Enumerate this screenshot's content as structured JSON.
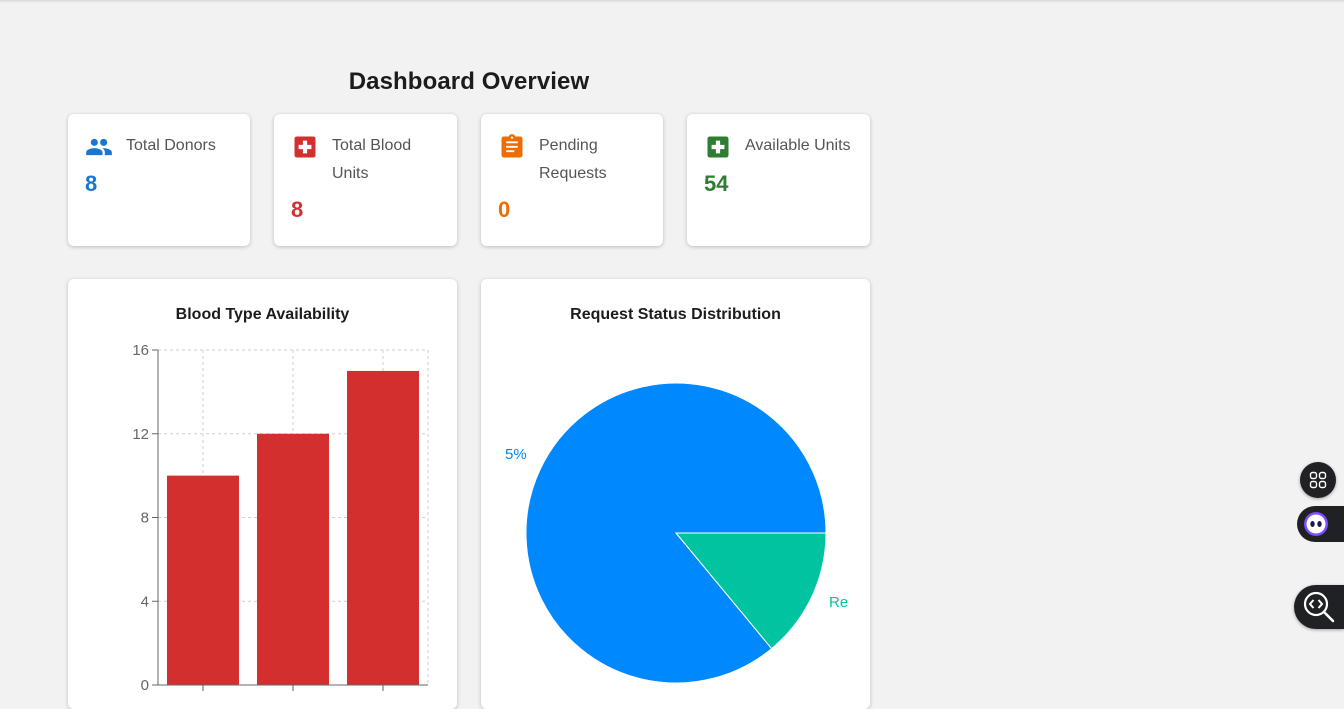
{
  "page": {
    "title": "Dashboard Overview"
  },
  "stats": [
    {
      "label": "Total Donors",
      "value": "8",
      "color": "#1976d2",
      "icon": "people-icon"
    },
    {
      "label": "Total Blood Units",
      "value": "8",
      "color": "#d32f2f",
      "icon": "medical-cross-icon"
    },
    {
      "label": "Pending Requests",
      "value": "0",
      "color": "#ef6c00",
      "icon": "clipboard-icon"
    },
    {
      "label": "Available Units",
      "value": "54",
      "color": "#2e7d32",
      "icon": "hospital-plus-icon"
    }
  ],
  "bar_panel": {
    "title": "Blood Type Availability"
  },
  "pie_panel": {
    "title": "Request Status Distribution"
  },
  "chart_data": [
    {
      "type": "bar",
      "title": "Blood Type Availability",
      "categories": [
        "",
        "",
        ""
      ],
      "values": [
        10,
        12,
        15
      ],
      "ylim": [
        0,
        16
      ],
      "yticks": [
        "0",
        "4",
        "8",
        "12",
        "16"
      ],
      "grid": true,
      "color": "#d32f2f"
    },
    {
      "type": "pie",
      "title": "Request Status Distribution",
      "values": [
        86,
        14
      ],
      "colors": [
        "#0088fe",
        "#00c49f"
      ],
      "visible_labels": [
        "5%",
        "Re"
      ]
    }
  ],
  "floating_tools": [
    "apps-grid-icon",
    "assistant-bot-icon",
    "code-search-icon"
  ]
}
